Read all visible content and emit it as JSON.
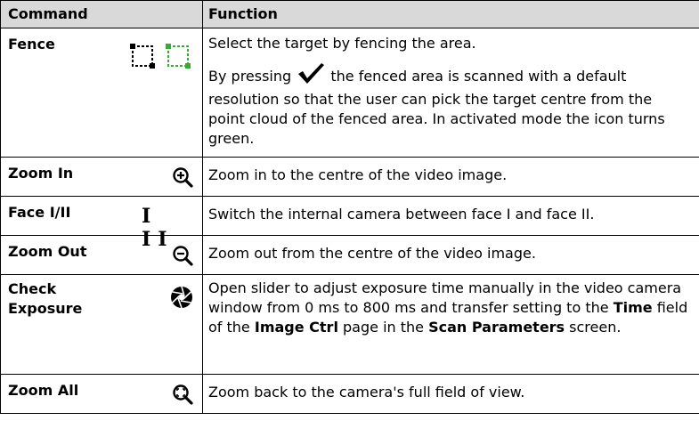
{
  "headers": {
    "command": "Command",
    "function": "Function"
  },
  "rows": {
    "fence": {
      "command": "Fence",
      "icon": "fence-icon",
      "p1": "Select the target by fencing the area.",
      "p2_a": "By pressing",
      "p2_icon": "checkmark-icon",
      "p2_b": "the fenced area is scanned with a default resolution so that the user can pick the target centre from the point cloud of the fenced area. In activated mode the icon turns green."
    },
    "zoom_in": {
      "command": "Zoom In",
      "icon": "zoom-in-icon",
      "desc": "Zoom in to the centre of the video image."
    },
    "face": {
      "command": "Face I/II",
      "icon": "face-I-II-icon",
      "icon_text": "I II",
      "desc": "Switch the internal camera between face I and face II."
    },
    "zoom_out": {
      "command": "Zoom Out",
      "icon": "zoom-out-icon",
      "desc": "Zoom out from the centre of the video image."
    },
    "check_exposure": {
      "command_line1": "Check",
      "command_line2": "Exposure",
      "icon": "aperture-icon",
      "d1": "Open slider to adjust exposure time manually in the video camera window from 0 ms to 800 ms and transfer setting to the",
      "d2": "Time",
      "d3": "field of the",
      "d4": "Image Ctrl",
      "d5": "page in the",
      "d6": "Scan Parameters",
      "d7": "screen."
    },
    "zoom_all": {
      "command": "Zoom All",
      "icon": "zoom-all-icon",
      "desc": "Zoom back to the camera's full field of view."
    }
  },
  "colors": {
    "header_bg": "#d9d9d9",
    "fence_active": "#3aa935"
  }
}
